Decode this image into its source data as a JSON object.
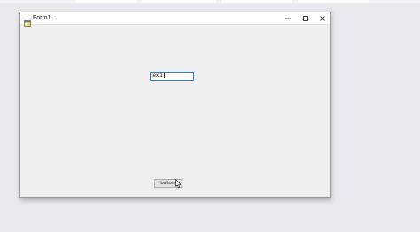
{
  "window": {
    "title": "Form1",
    "icons": {
      "app": "form-app-icon",
      "minimize": "minimize-icon",
      "maximize": "maximize-icon",
      "close": "close-icon"
    }
  },
  "form": {
    "textbox_value": "text1",
    "button_label": "button1"
  },
  "cursor": "mouse-pointer-icon",
  "colors": {
    "titlebar": "#ffffff",
    "client_background": "#efefef",
    "desktop": "#e9e9ee",
    "textbox_focus_border": "#2e7bd2",
    "button_face": "#e1e1e1"
  }
}
